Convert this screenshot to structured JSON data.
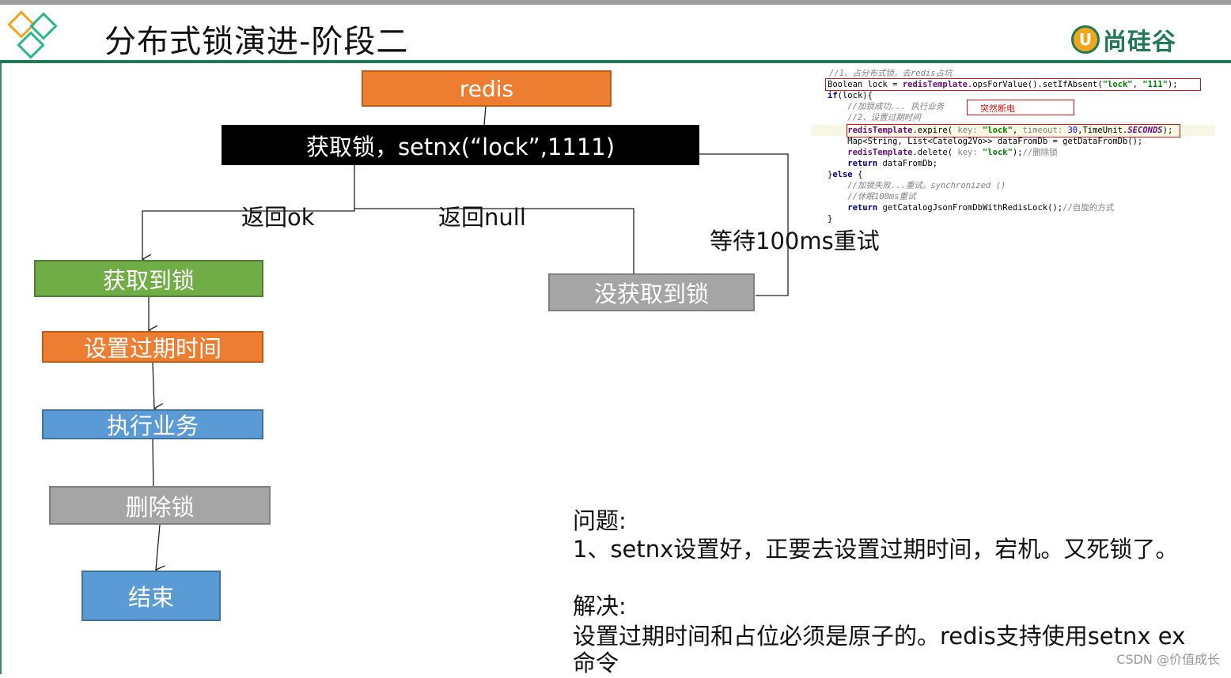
{
  "slide": {
    "title": "分布式锁演进-阶段二",
    "logo_badge": "U",
    "logo_text": "尚硅谷"
  },
  "flow": {
    "redis": "redis",
    "acquire": "获取锁，setnx(“lock”,1111)",
    "return_ok": "返回ok",
    "return_null": "返回null",
    "wait_retry": "等待100ms重试",
    "got_lock": "获取到锁",
    "set_expire": "设置过期时间",
    "execute": "执行业务",
    "delete_lock": "删除锁",
    "end": "结束",
    "no_lock": "没获取到锁"
  },
  "code_snippet": {
    "line1": "//1、占分布式锁。去redis占坑",
    "line2_a": "Boolean lock = ",
    "line2_b": "redisTemplate",
    "line2_c": ".opsForValue().setIfAbsent(",
    "line2_d": "\"lock\"",
    "line2_e": ", ",
    "line2_f": "\"111\"",
    "line2_g": ");",
    "line3_a": "if",
    "line3_b": "(lock){",
    "line4": "    //加锁成功... 执行业务",
    "line5": "    //2、设置过期时间",
    "line6_a": "    redisTemplate",
    "line6_b": ".expire( ",
    "line6_c": "key: ",
    "line6_d": "\"lock\"",
    "line6_e": ", ",
    "line6_f": "timeout: ",
    "line6_g": "30",
    "line6_h": ",TimeUnit.",
    "line6_i": "SECONDS",
    "line6_j": ");",
    "line7": "    Map<String, List<Catelog2Vo>> dataFromDb = getDataFromDb();",
    "line8_a": "    redisTemplate",
    "line8_b": ".delete( ",
    "line8_c": "key: ",
    "line8_d": "\"lock\"",
    "line8_e": ");",
    "line8_f": "//删除锁",
    "line9_a": "    return",
    "line9_b": " dataFromDb;",
    "line10_a": "}",
    "line10_b": "else",
    "line10_c": " {",
    "line11": "    //加锁失败...重试。synchronized ()",
    "line12": "    //休眠100ms重试",
    "line13_a": "    return",
    "line13_b": " getCatalogJsonFromDbWithRedisLock();",
    "line13_c": "//自旋的方式",
    "line14": "}",
    "annotation": "突然断电"
  },
  "notes": {
    "problem_heading": "问题:",
    "problem_text": "1、setnx设置好，正要去设置过期时间，宕机。又死锁了。",
    "solution_heading": "解决:",
    "solution_text_1": "设置过期时间和占位必须是原子的。redis支持使用setnx ex",
    "solution_text_2": "命令"
  },
  "footer": "CSDN @价值成长",
  "colors": {
    "orange": "#ed7d31",
    "green": "#70ad47",
    "blue": "#5b9bd5",
    "gray": "#a5a5a5",
    "brand_green": "#1f7a54"
  }
}
